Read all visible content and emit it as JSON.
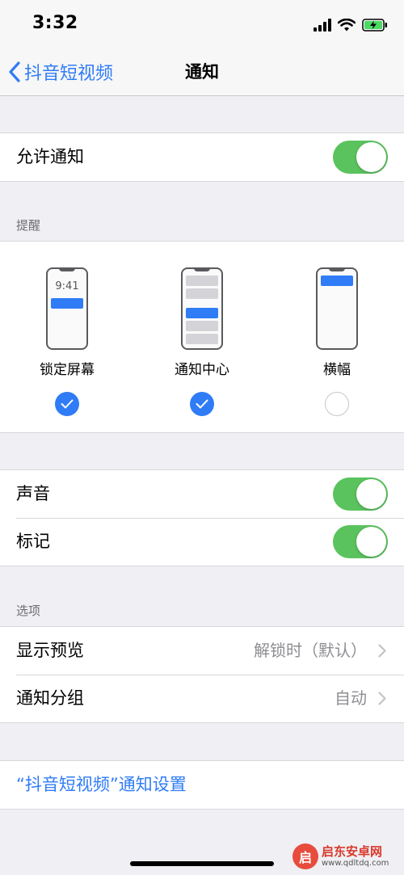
{
  "status": {
    "time": "3:32"
  },
  "nav": {
    "back_label": "抖音短视频",
    "title": "通知"
  },
  "allow": {
    "label": "允许通知",
    "enabled": true
  },
  "alerts": {
    "header": "提醒",
    "lock_time": "9:41",
    "options": [
      {
        "label": "锁定屏幕",
        "checked": true
      },
      {
        "label": "通知中心",
        "checked": true
      },
      {
        "label": "横幅",
        "checked": false
      }
    ]
  },
  "sound": {
    "label": "声音",
    "enabled": true
  },
  "badge": {
    "label": "标记",
    "enabled": true
  },
  "options": {
    "header": "选项",
    "show_previews": {
      "label": "显示预览",
      "value": "解锁时（默认）"
    },
    "grouping": {
      "label": "通知分组",
      "value": "自动"
    }
  },
  "app_settings_link": "“抖音短视频”通知设置",
  "watermark": {
    "title": "启东安卓网",
    "url": "www.qdltdq.com"
  },
  "colors": {
    "accent": "#2f7cf6",
    "toggle_on": "#5ac35d",
    "background": "#efeff4"
  }
}
